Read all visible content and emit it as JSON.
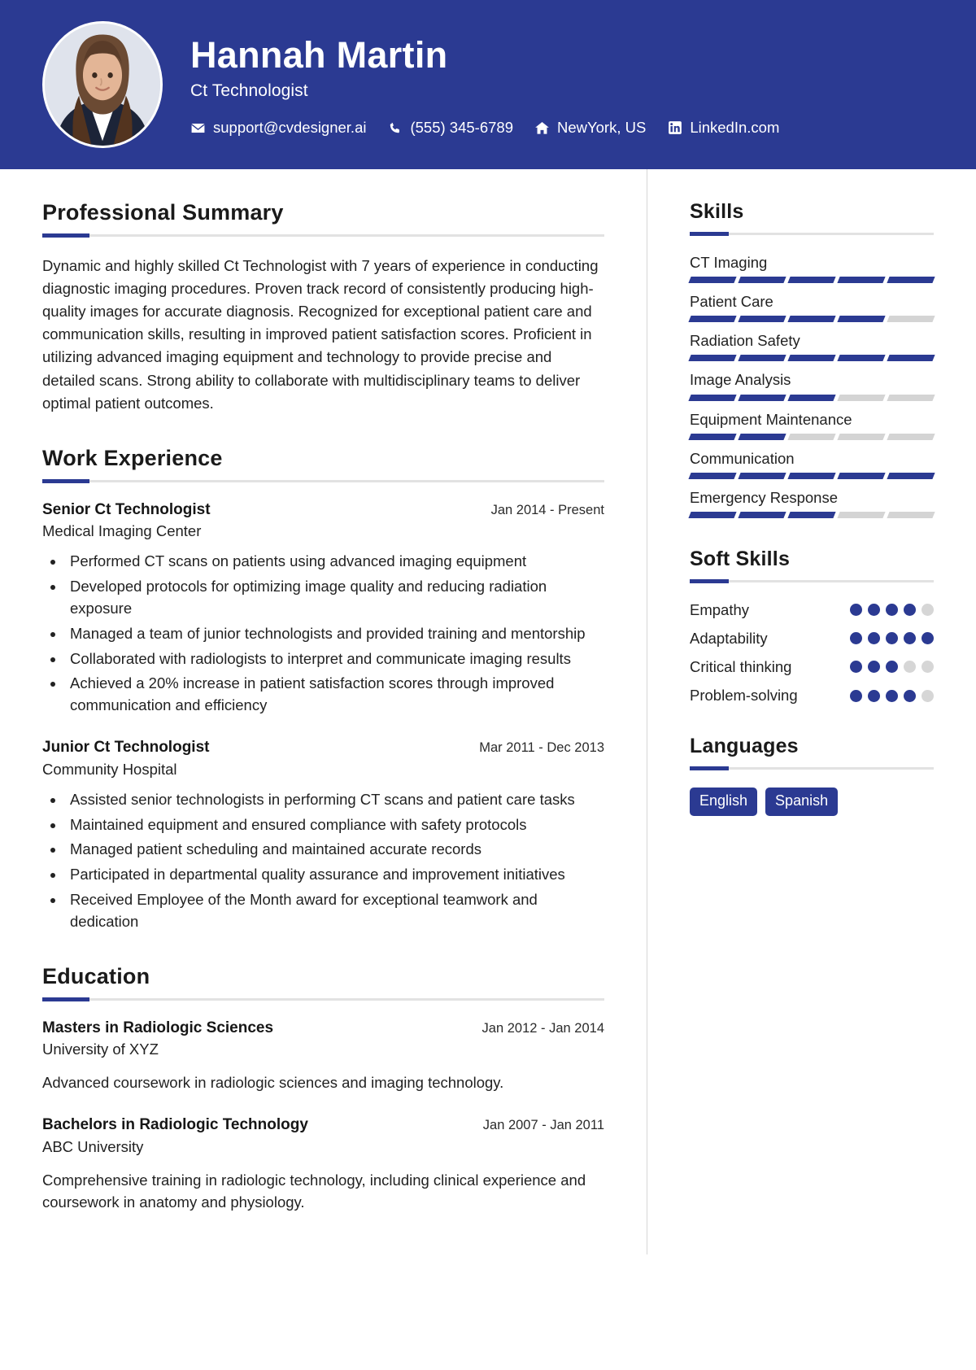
{
  "theme": {
    "accent": "#2b3a92",
    "header_bg": "#2b3a92",
    "track": "#d4d4d4",
    "text": "#222222"
  },
  "header": {
    "name": "Hannah Martin",
    "role": "Ct Technologist",
    "avatar_alt": "profile-photo",
    "contacts": [
      {
        "icon": "envelope-icon",
        "label": "support@cvdesigner.ai"
      },
      {
        "icon": "phone-icon",
        "label": "(555) 345-6789"
      },
      {
        "icon": "home-icon",
        "label": "NewYork, US"
      },
      {
        "icon": "linkedin-icon",
        "label": "LinkedIn.com"
      }
    ]
  },
  "summary": {
    "title": "Professional Summary",
    "text": "Dynamic and highly skilled Ct Technologist with 7 years of experience in conducting diagnostic imaging procedures. Proven track record of consistently producing high-quality images for accurate diagnosis. Recognized for exceptional patient care and communication skills, resulting in improved patient satisfaction scores. Proficient in utilizing advanced imaging equipment and technology to provide precise and detailed scans. Strong ability to collaborate with multidisciplinary teams to deliver optimal patient outcomes."
  },
  "experience": {
    "title": "Work Experience",
    "entries": [
      {
        "title": "Senior Ct Technologist",
        "date": "Jan 2014 - Present",
        "org": "Medical Imaging Center",
        "bullets": [
          "Performed CT scans on patients using advanced imaging equipment",
          "Developed protocols for optimizing image quality and reducing radiation exposure",
          "Managed a team of junior technologists and provided training and mentorship",
          "Collaborated with radiologists to interpret and communicate imaging results",
          "Achieved a 20% increase in patient satisfaction scores through improved communication and efficiency"
        ]
      },
      {
        "title": "Junior Ct Technologist",
        "date": "Mar 2011 - Dec 2013",
        "org": "Community Hospital",
        "bullets": [
          "Assisted senior technologists in performing CT scans and patient care tasks",
          "Maintained equipment and ensured compliance with safety protocols",
          "Managed patient scheduling and maintained accurate records",
          "Participated in departmental quality assurance and improvement initiatives",
          "Received Employee of the Month award for exceptional teamwork and dedication"
        ]
      }
    ]
  },
  "education": {
    "title": "Education",
    "entries": [
      {
        "title": "Masters in Radiologic Sciences",
        "date": "Jan 2012 - Jan 2014",
        "org": "University of XYZ",
        "desc": "Advanced coursework in radiologic sciences and imaging technology."
      },
      {
        "title": "Bachelors in Radiologic Technology",
        "date": "Jan 2007 - Jan 2011",
        "org": "ABC University",
        "desc": "Comprehensive training in radiologic technology, including clinical experience and coursework in anatomy and physiology."
      }
    ]
  },
  "skills": {
    "title": "Skills",
    "max": 5,
    "items": [
      {
        "name": "CT Imaging",
        "level": 5
      },
      {
        "name": "Patient Care",
        "level": 4
      },
      {
        "name": "Radiation Safety",
        "level": 5
      },
      {
        "name": "Image Analysis",
        "level": 3
      },
      {
        "name": "Equipment Maintenance",
        "level": 2
      },
      {
        "name": "Communication",
        "level": 5
      },
      {
        "name": "Emergency Response",
        "level": 3
      }
    ]
  },
  "soft_skills": {
    "title": "Soft Skills",
    "max": 5,
    "items": [
      {
        "name": "Empathy",
        "level": 4
      },
      {
        "name": "Adaptability",
        "level": 5
      },
      {
        "name": "Critical thinking",
        "level": 3
      },
      {
        "name": "Problem-solving",
        "level": 4
      }
    ]
  },
  "languages": {
    "title": "Languages",
    "items": [
      "English",
      "Spanish"
    ]
  }
}
